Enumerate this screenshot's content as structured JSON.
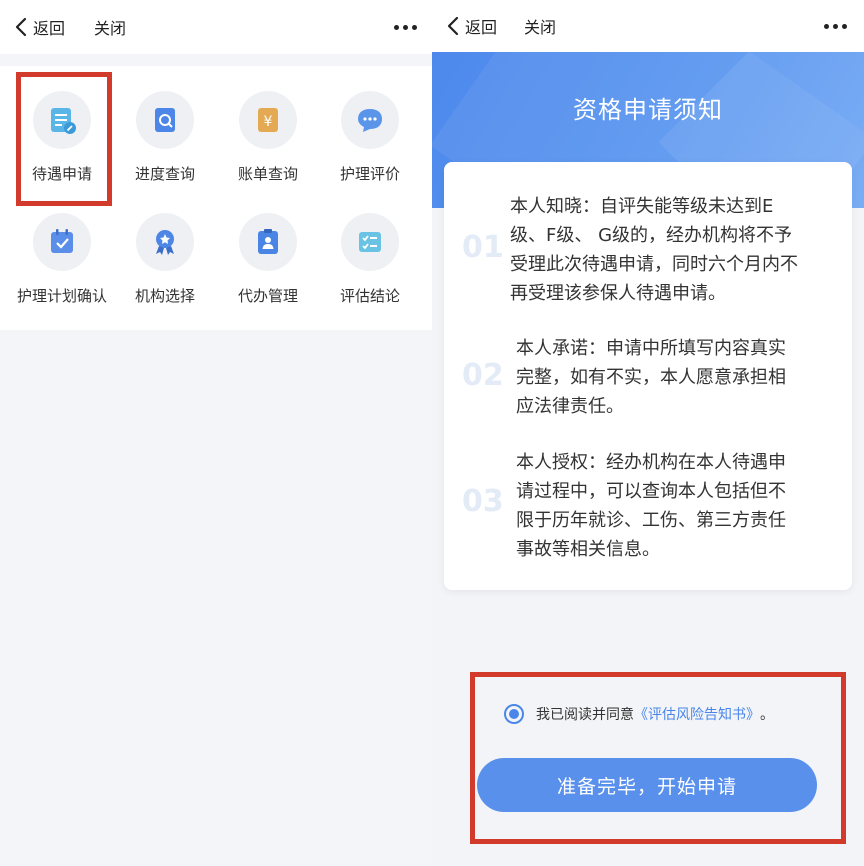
{
  "left": {
    "navbar": {
      "back_label": "返回",
      "close_label": "关闭"
    },
    "grid": [
      {
        "label": "待遇申请",
        "icon": "benefit-apply-icon"
      },
      {
        "label": "进度查询",
        "icon": "progress-query-icon"
      },
      {
        "label": "账单查询",
        "icon": "bill-query-icon"
      },
      {
        "label": "护理评价",
        "icon": "care-review-icon"
      },
      {
        "label": "护理计划确认",
        "icon": "care-plan-confirm-icon"
      },
      {
        "label": "机构选择",
        "icon": "institution-select-icon"
      },
      {
        "label": "代办管理",
        "icon": "agent-manage-icon"
      },
      {
        "label": "评估结论",
        "icon": "assessment-result-icon"
      }
    ]
  },
  "right": {
    "navbar": {
      "back_label": "返回",
      "close_label": "关闭"
    },
    "hero_title": "资格申请须知",
    "notices": [
      {
        "num": "01",
        "lines": [
          "本人知晓：自评失能等级未达到E",
          "级、F级、 G级的，经办机构将不予",
          "受理此次待遇申请，同时六个月内不",
          "再受理该参保人待遇申请。"
        ]
      },
      {
        "num": "02",
        "lines": [
          "本人承诺：申请中所填写内容真实",
          "完整，如有不实，本人愿意承担相",
          "应法律责任。"
        ]
      },
      {
        "num": "03",
        "lines": [
          "本人授权：经办机构在本人待遇申",
          "请过程中，可以查询本人包括但不",
          "限于历年就诊、工伤、第三方责任",
          "事故等相关信息。"
        ]
      }
    ],
    "agree": {
      "prefix": "我已阅读并同意",
      "link": "《评估风险告知书》",
      "suffix": "。"
    },
    "start_button": "准备完毕，开始申请"
  },
  "colors": {
    "accent": "#4a86ea",
    "highlight": "#d23b2c",
    "hero": "#5a96f0"
  }
}
